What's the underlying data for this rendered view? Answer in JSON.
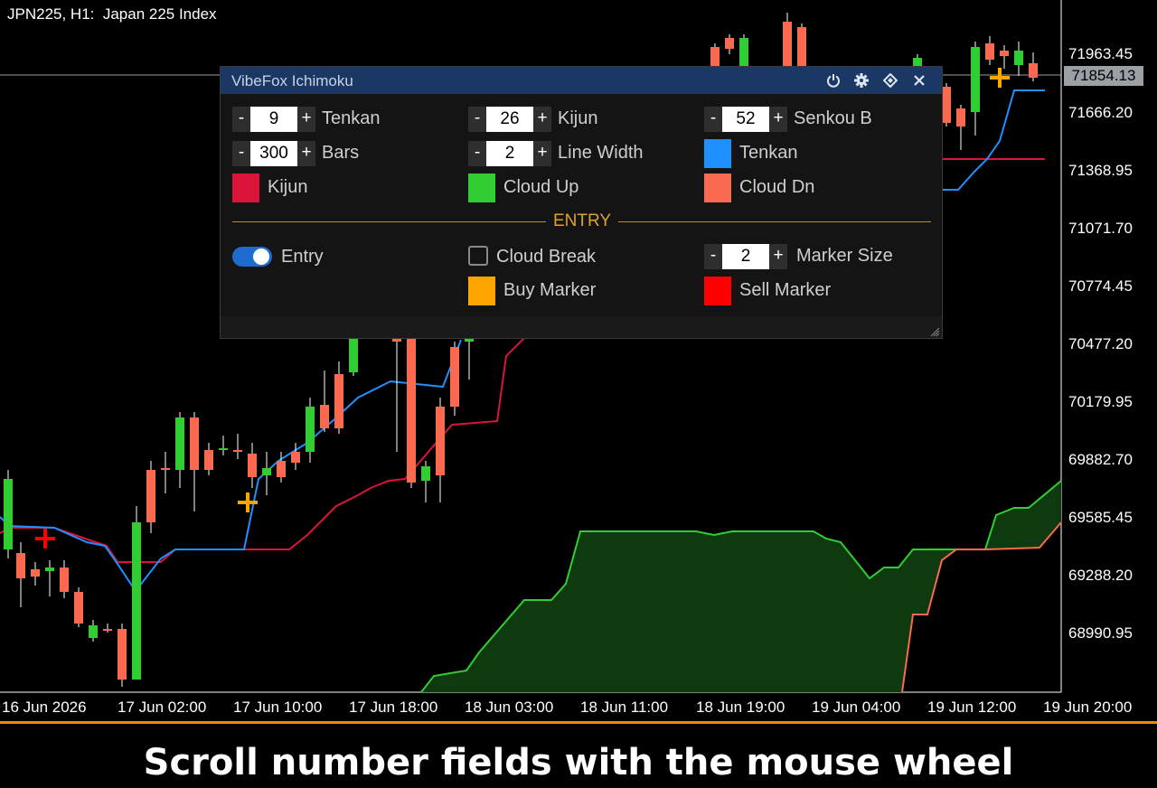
{
  "chart": {
    "title": "JPN225, H1:  Japan 225 Index",
    "price_labels": [
      "71963.45",
      "71666.20",
      "71368.95",
      "71071.70",
      "70774.45",
      "70477.20",
      "70179.95",
      "69882.70",
      "69585.45",
      "69288.20",
      "68990.95"
    ],
    "current_price": "71854.13",
    "time_labels": [
      "16 Jun 2026",
      "17 Jun 02:00",
      "17 Jun 10:00",
      "17 Jun 18:00",
      "18 Jun 03:00",
      "18 Jun 11:00",
      "18 Jun 19:00",
      "19 Jun 04:00",
      "19 Jun 12:00",
      "19 Jun 20:00"
    ],
    "colors": {
      "bull": "#32cd32",
      "bear": "#fa6a50",
      "tenkan": "#1e90ff",
      "kijun": "#dc143c",
      "cloud_up": "#32cd32",
      "cloud_dn": "#fa6a50",
      "buy_marker": "#ffa500",
      "sell_marker": "#ff0000"
    }
  },
  "panel": {
    "title": "VibeFox Ichimoku",
    "header_icons": [
      "power-icon",
      "gear-icon",
      "diamond-icon",
      "close-icon"
    ],
    "tenkan": {
      "value": "9",
      "label": "Tenkan"
    },
    "kijun": {
      "value": "26",
      "label": "Kijun"
    },
    "senkou_b": {
      "value": "52",
      "label": "Senkou B"
    },
    "bars": {
      "value": "300",
      "label": "Bars"
    },
    "line_width": {
      "value": "2",
      "label": "Line Width"
    },
    "tenkan_color": {
      "label": "Tenkan",
      "color": "#1e90ff"
    },
    "kijun_color": {
      "label": "Kijun",
      "color": "#dc143c"
    },
    "cloud_up_color": {
      "label": "Cloud Up",
      "color": "#32cd32"
    },
    "cloud_dn_color": {
      "label": "Cloud Dn",
      "color": "#fa6a50"
    },
    "section_entry": "ENTRY",
    "entry_toggle": {
      "label": "Entry",
      "on": true
    },
    "cloud_break": {
      "label": "Cloud Break",
      "checked": false
    },
    "marker_size": {
      "value": "2",
      "label": "Marker Size"
    },
    "buy_marker": {
      "label": "Buy Marker",
      "color": "#ffa500"
    },
    "sell_marker": {
      "label": "Sell Marker",
      "color": "#ff0000"
    },
    "minus": "-",
    "plus": "+"
  },
  "caption": "Scroll number fields with the mouse wheel"
}
